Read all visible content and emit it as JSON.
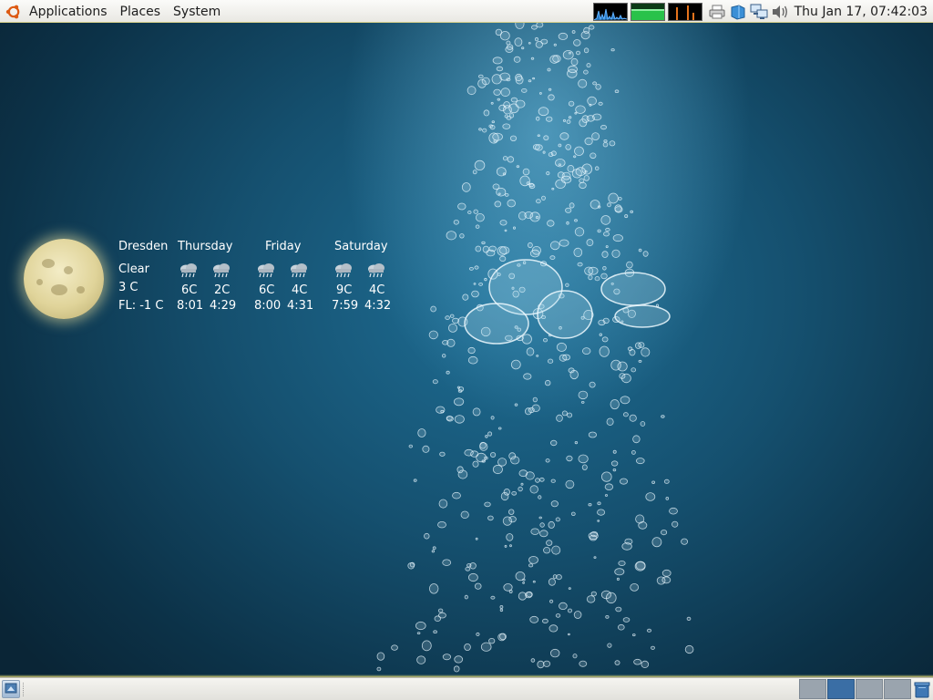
{
  "top_panel": {
    "menus": [
      "Applications",
      "Places",
      "System"
    ],
    "clock": "Thu Jan 17, 07:42:03",
    "tray_icons": [
      "system-monitor-cpu",
      "system-monitor-memory",
      "system-monitor-network",
      "printer-icon",
      "notes-icon",
      "network-icon",
      "volume-icon"
    ]
  },
  "weather": {
    "city": "Dresden",
    "condition": "Clear",
    "temperature": "3 C",
    "feels_like": "FL: -1 C",
    "days": [
      {
        "name": "Thursday",
        "icons": [
          "rain-cloud-icon",
          "rain-cloud-icon"
        ],
        "high": "6C",
        "low": "2C",
        "sunrise": "8:01",
        "sunset": "4:29"
      },
      {
        "name": "Friday",
        "icons": [
          "rain-cloud-icon",
          "rain-cloud-icon"
        ],
        "high": "6C",
        "low": "4C",
        "sunrise": "8:00",
        "sunset": "4:31"
      },
      {
        "name": "Saturday",
        "icons": [
          "rain-cloud-icon",
          "rain-cloud-icon"
        ],
        "high": "9C",
        "low": "4C",
        "sunrise": "7:59",
        "sunset": "4:32"
      }
    ]
  },
  "bottom_panel": {
    "workspaces": 4,
    "active_workspace": 2
  },
  "colors": {
    "panel": "#eeede9",
    "desktop_dark": "#0c3147",
    "desktop_light": "#5fb6dc",
    "workspace_active": "#3a6ea5"
  }
}
